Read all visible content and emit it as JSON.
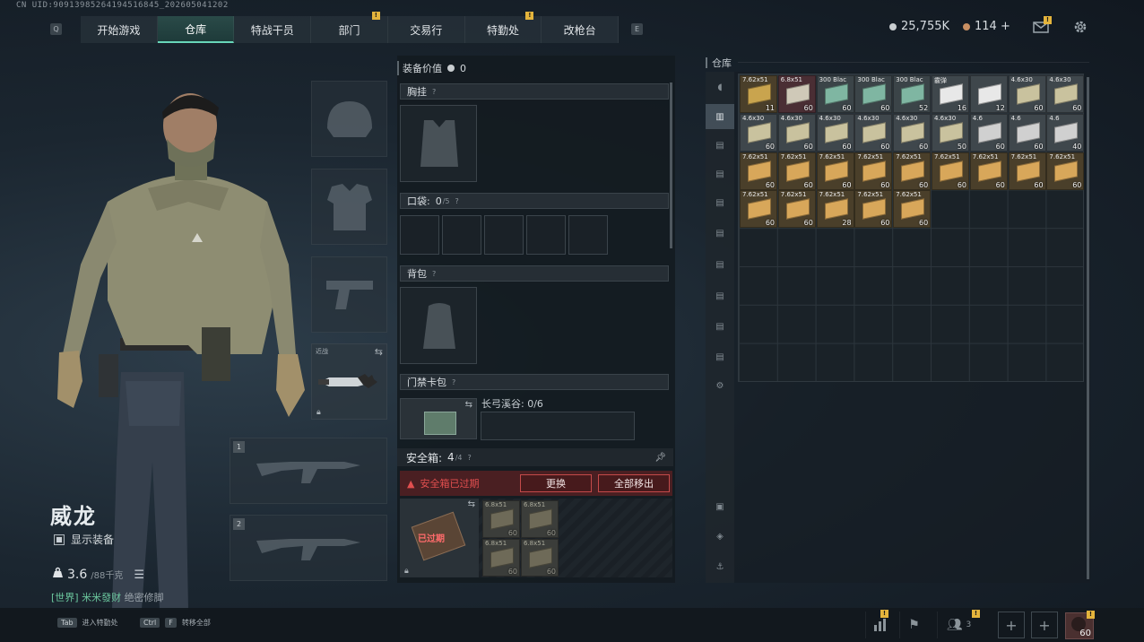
{
  "uid": "CN UID:9091398526419451684​5_20260504120​2",
  "nav": {
    "q_key": "Q",
    "e_key": "E",
    "tabs": [
      {
        "label": "开始游戏",
        "badge": ""
      },
      {
        "label": "仓库",
        "badge": "",
        "active": true
      },
      {
        "label": "特战干员",
        "badge": ""
      },
      {
        "label": "部门",
        "badge": "!"
      },
      {
        "label": "交易行",
        "badge": ""
      },
      {
        "label": "特勤处",
        "badge": "!"
      },
      {
        "label": "改枪台",
        "badge": ""
      }
    ]
  },
  "currency": {
    "silver": "25,755K",
    "bronze": "114 +"
  },
  "character": {
    "name": "威龙",
    "show_equipment": "显示装备",
    "weight": "3.6",
    "weight_max": "/88千克",
    "status_tag": "[世界]",
    "status_green": "米米發财",
    "status_rest": "绝密修脚"
  },
  "melee_label": "近战",
  "slot_numbers": [
    "1",
    "2"
  ],
  "middle": {
    "equip_value_label": "装备价值",
    "equip_value": "0",
    "chest_rig": "胸挂",
    "pockets_label": "口袋:",
    "pockets_value": "0",
    "pockets_max": "/5",
    "backpack": "背包",
    "keycard": "门禁卡包",
    "keycard_location": "长弓溪谷: 0/6",
    "safe_label": "安全箱:",
    "safe_value": "4",
    "safe_max": "/4",
    "safe_expired": "安全箱已过期",
    "btn_replace": "更换",
    "btn_move_all": "全部移出",
    "expired_tag": "已过期",
    "safe_items": [
      {
        "tag": "6.8x51",
        "count": "60"
      },
      {
        "tag": "6.8x51",
        "count": "60"
      },
      {
        "tag": "6.8x51",
        "count": "60"
      },
      {
        "tag": "6.8x51",
        "count": "60"
      }
    ]
  },
  "warehouse": {
    "title": "仓库",
    "items": [
      {
        "tag": "7.62x51",
        "count": "11",
        "color": "#c9a44e",
        "bg": "#4a3f2a"
      },
      {
        "tag": "6.8x51",
        "count": "60",
        "color": "#cfc9b8",
        "bg": "#4a2e34"
      },
      {
        "tag": "300 Blac",
        "count": "60",
        "color": "#7fb6a2",
        "bg": "#3b4448"
      },
      {
        "tag": "300 Blac",
        "count": "60",
        "color": "#7fb6a2",
        "bg": "#3b4448"
      },
      {
        "tag": "300 Blac",
        "count": "52",
        "color": "#7fb6a2",
        "bg": "#3b4448"
      },
      {
        "tag": "霰弹",
        "count": "16",
        "color": "#e8e8e8",
        "bg": "#3f474c"
      },
      {
        "tag": "",
        "count": "12",
        "color": "#e8e8e8",
        "bg": "#3f474c"
      },
      {
        "tag": "4.6x30",
        "count": "60",
        "color": "#c9c29e",
        "bg": "#3f474c"
      },
      {
        "tag": "4.6x30",
        "count": "60",
        "color": "#c9c29e",
        "bg": "#3f474c"
      },
      {
        "tag": "4.6x30",
        "count": "60",
        "color": "#c9c29e",
        "bg": "#3f474c"
      },
      {
        "tag": "4.6x30",
        "count": "60",
        "color": "#c9c29e",
        "bg": "#3f474c"
      },
      {
        "tag": "4.6x30",
        "count": "60",
        "color": "#c9c29e",
        "bg": "#3f474c"
      },
      {
        "tag": "4.6x30",
        "count": "60",
        "color": "#c9c29e",
        "bg": "#3f474c"
      },
      {
        "tag": "4.6x30",
        "count": "60",
        "color": "#c9c29e",
        "bg": "#3f474c"
      },
      {
        "tag": "4.6x30",
        "count": "50",
        "color": "#c9c29e",
        "bg": "#3f474c"
      },
      {
        "tag": "4.6",
        "count": "60",
        "color": "#d0d0d0",
        "bg": "#3f474c"
      },
      {
        "tag": "4.6",
        "count": "60",
        "color": "#d0d0d0",
        "bg": "#3f474c"
      },
      {
        "tag": "4.6",
        "count": "40",
        "color": "#d0d0d0",
        "bg": "#3f474c"
      },
      {
        "tag": "7.62x51",
        "count": "60",
        "color": "#d8a75a",
        "bg": "#4a3f2a"
      },
      {
        "tag": "7.62x51",
        "count": "60",
        "color": "#d8a75a",
        "bg": "#4a3f2a"
      },
      {
        "tag": "7.62x51",
        "count": "60",
        "color": "#d8a75a",
        "bg": "#4a3f2a"
      },
      {
        "tag": "7.62x51",
        "count": "60",
        "color": "#d8a75a",
        "bg": "#4a3f2a"
      },
      {
        "tag": "7.62x51",
        "count": "60",
        "color": "#d8a75a",
        "bg": "#4a3f2a"
      },
      {
        "tag": "7.62x51",
        "count": "60",
        "color": "#d8a75a",
        "bg": "#4a3f2a"
      },
      {
        "tag": "7.62x51",
        "count": "60",
        "color": "#d8a75a",
        "bg": "#4a3f2a"
      },
      {
        "tag": "7.62x51",
        "count": "60",
        "color": "#d8a75a",
        "bg": "#4a3f2a"
      },
      {
        "tag": "7.62x51",
        "count": "60",
        "color": "#d8a75a",
        "bg": "#4a3f2a"
      },
      {
        "tag": "7.62x51",
        "count": "60",
        "color": "#d8a75a",
        "bg": "#4a3f2a"
      },
      {
        "tag": "7.62x51",
        "count": "60",
        "color": "#d8a75a",
        "bg": "#4a3f2a"
      },
      {
        "tag": "7.62x51",
        "count": "28",
        "color": "#d8a75a",
        "bg": "#4a3f2a"
      },
      {
        "tag": "7.62x51",
        "count": "60",
        "color": "#d8a75a",
        "bg": "#4a3f2a"
      },
      {
        "tag": "7.62x51",
        "count": "60",
        "color": "#d8a75a",
        "bg": "#4a3f2a"
      }
    ]
  },
  "bottom": {
    "hint1_key": "Tab",
    "hint1_text": "进入特勤处",
    "hint2_key1": "Ctrl",
    "hint2_key2": "F",
    "hint2_text": "转移全部",
    "team_count": "3",
    "avatar_level": "60"
  },
  "icons": [
    "cog-icon",
    "mail-icon",
    "stats-icon",
    "flag-icon",
    "team-icon",
    "plus-icon",
    "lock-icon",
    "swap-icon",
    "list-icon",
    "pin-icon",
    "warning-icon"
  ]
}
